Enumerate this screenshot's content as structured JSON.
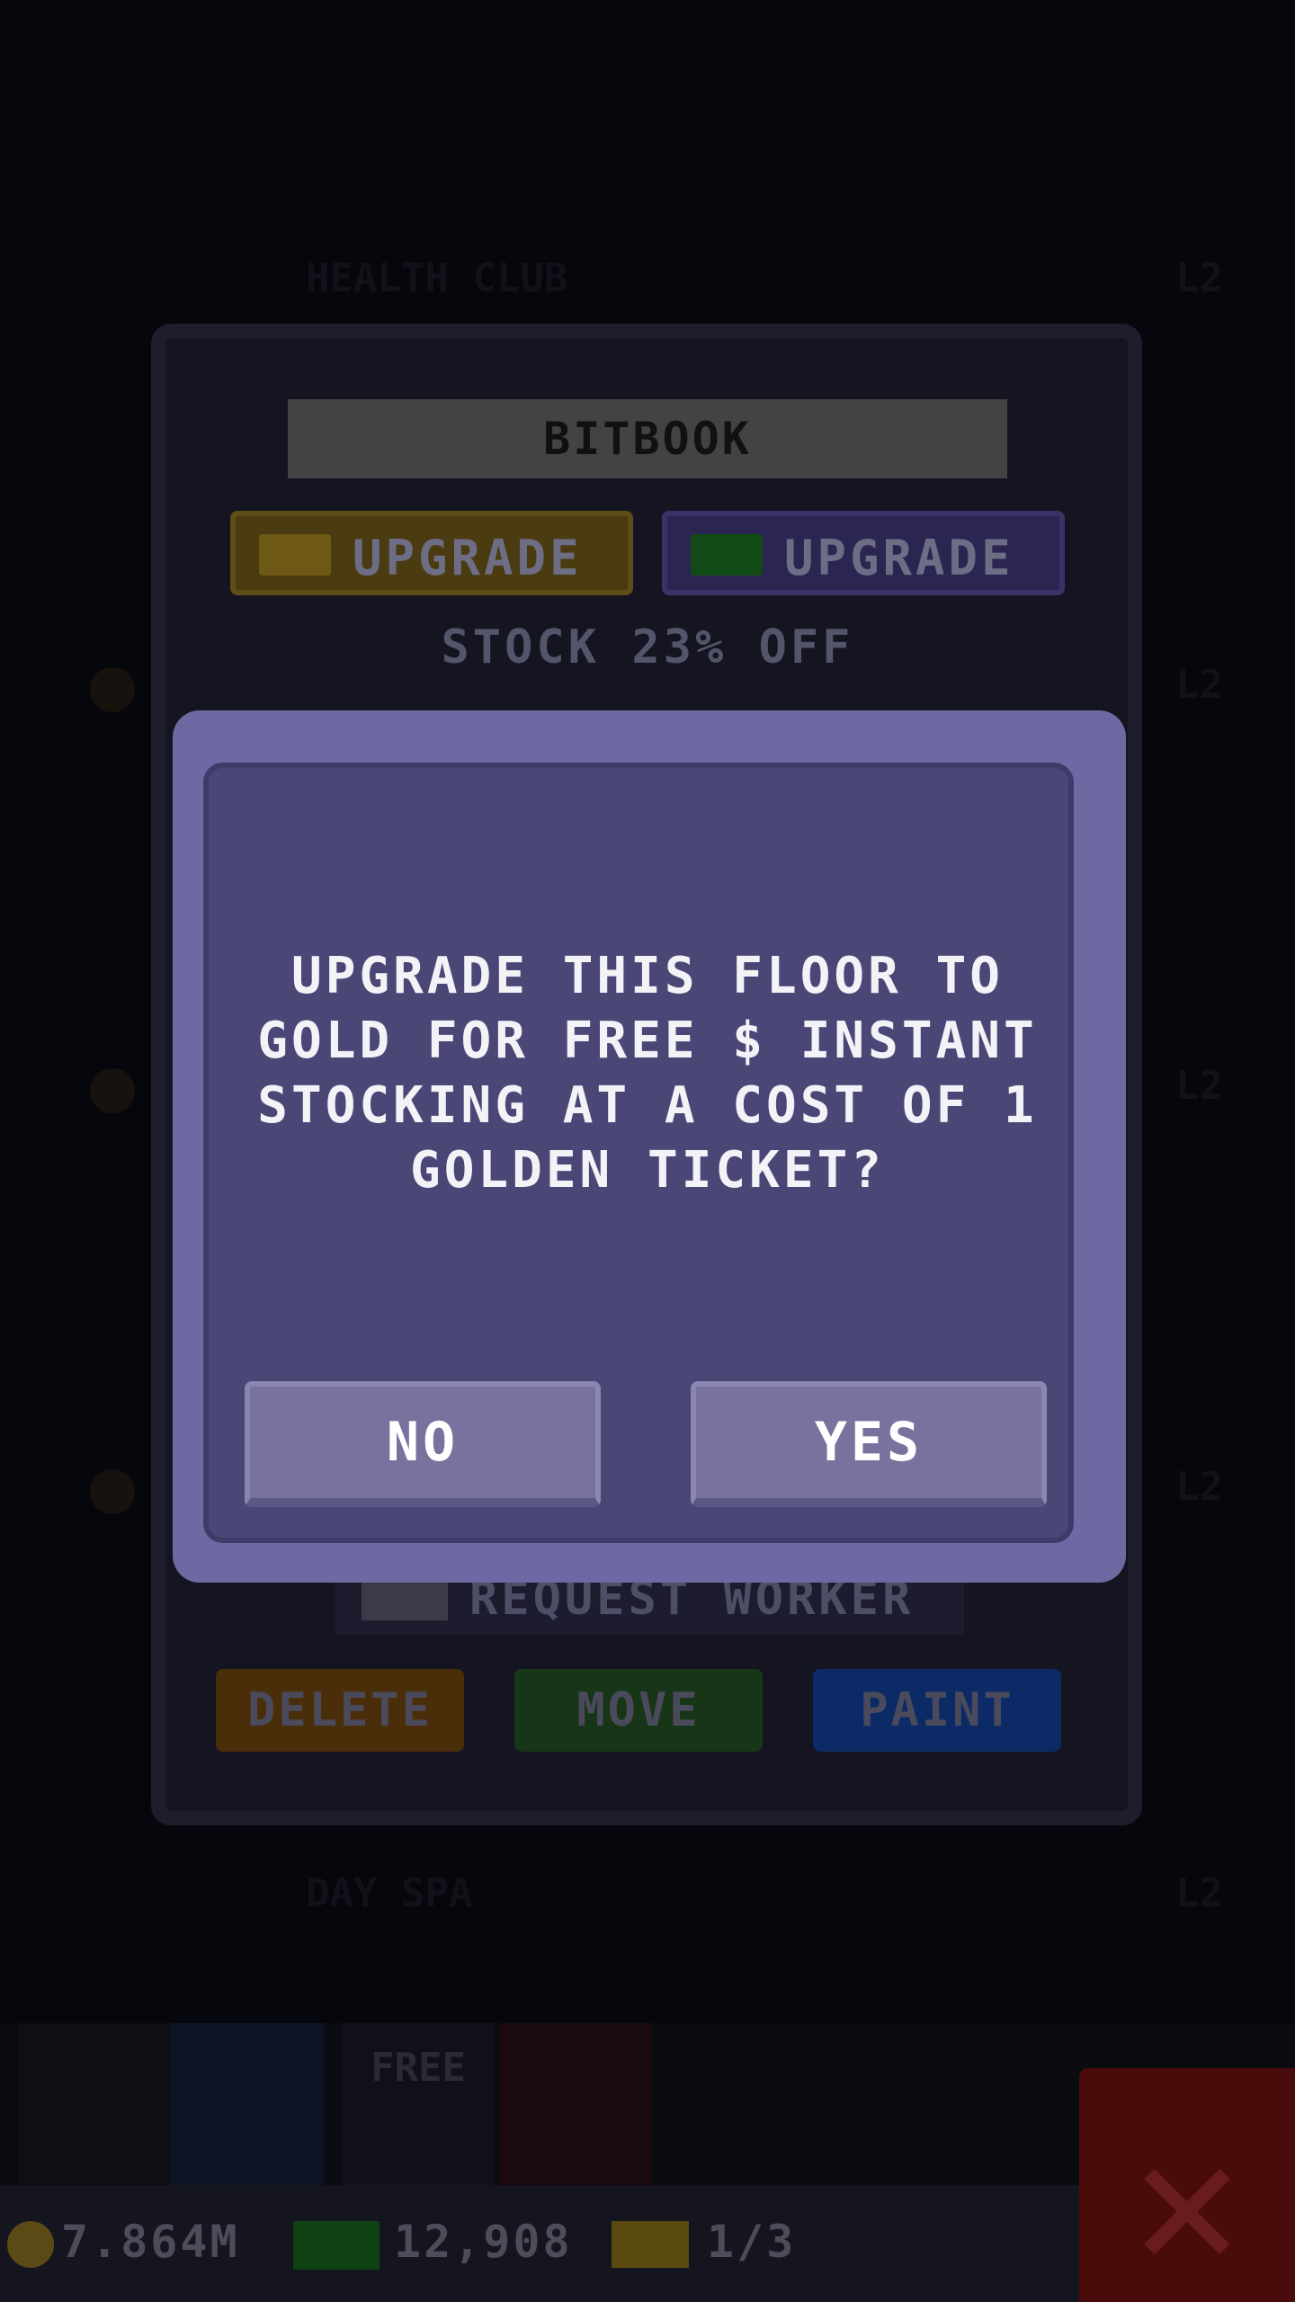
{
  "background_rows": [
    {
      "name": "HEALTH CLUB",
      "level": "L2"
    },
    {
      "name": "",
      "level": "L2"
    },
    {
      "name": "",
      "level": "L2"
    },
    {
      "name": "",
      "level": "L2"
    },
    {
      "name": "DAY SPA",
      "level": "L2"
    }
  ],
  "floor_panel": {
    "title": "BITBOOK",
    "upgrade_coins_label": "UPGRADE",
    "upgrade_bux_label": "UPGRADE",
    "stock_discount": "STOCK 23% OFF",
    "request_worker_label": "REQUEST WORKER",
    "delete_label": "DELETE",
    "move_label": "MOVE",
    "paint_label": "PAINT"
  },
  "dialog": {
    "lines": [
      "UPGRADE THIS FLOOR TO",
      "GOLD FOR FREE $ INSTANT",
      "STOCKING AT A COST OF 1",
      "GOLDEN TICKET?"
    ],
    "no_label": "NO",
    "yes_label": "YES"
  },
  "toolbar": {
    "free_label": "FREE"
  },
  "status": {
    "coins": "7.864M",
    "bux": "12,908",
    "tickets": "1/3"
  },
  "colors": {
    "dialog_outer": "#6e69a2",
    "dialog_inner": "#4a4777",
    "button": "#77739e",
    "text": "#f3f3f7"
  }
}
